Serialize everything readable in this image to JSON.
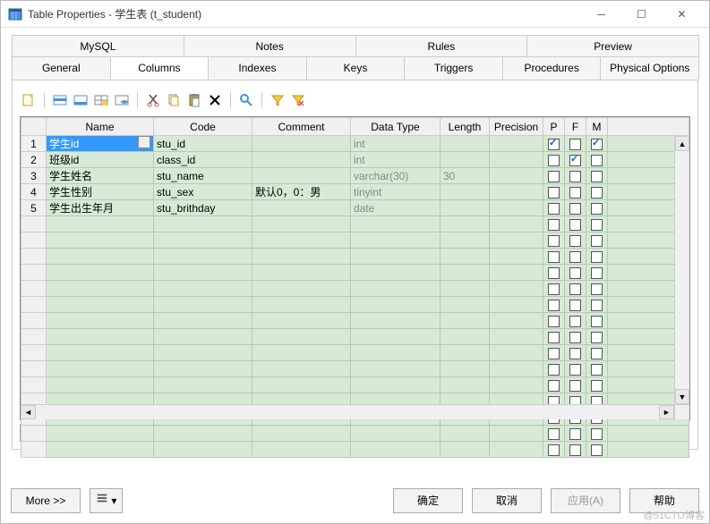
{
  "window": {
    "title": "Table Properties - 学生表 (t_student)"
  },
  "tabs_top": [
    "MySQL",
    "Notes",
    "Rules",
    "Preview"
  ],
  "tabs_bottom": [
    "General",
    "Columns",
    "Indexes",
    "Keys",
    "Triggers",
    "Procedures",
    "Physical Options"
  ],
  "active_tab": "Columns",
  "columns_header": [
    "",
    "Name",
    "Code",
    "Comment",
    "Data Type",
    "Length",
    "Precision",
    "P",
    "F",
    "M"
  ],
  "rows": [
    {
      "num": "1",
      "name": "学生id",
      "code": "stu_id",
      "comment": "",
      "datatype": "int",
      "length": "",
      "precision": "",
      "p": true,
      "f": false,
      "m": true,
      "selected": true
    },
    {
      "num": "2",
      "name": "班级id",
      "code": "class_id",
      "comment": "",
      "datatype": "int",
      "length": "",
      "precision": "",
      "p": false,
      "f": true,
      "m": false
    },
    {
      "num": "3",
      "name": "学生姓名",
      "code": "stu_name",
      "comment": "",
      "datatype": "varchar(30)",
      "length": "30",
      "precision": "",
      "p": false,
      "f": false,
      "m": false
    },
    {
      "num": "4",
      "name": "学生性别",
      "code": "stu_sex",
      "comment": "默认0，0：男",
      "datatype": "tinyint",
      "length": "",
      "precision": "",
      "p": false,
      "f": false,
      "m": false
    },
    {
      "num": "5",
      "name": "学生出生年月",
      "code": "stu_brithday",
      "comment": "",
      "datatype": "date",
      "length": "",
      "precision": "",
      "p": false,
      "f": false,
      "m": false
    }
  ],
  "empty_rows": 15,
  "footer": {
    "more": "More >>",
    "ok": "确定",
    "cancel": "取消",
    "apply": "应用(A)",
    "help": "帮助"
  },
  "watermark": "@51CTO博客"
}
